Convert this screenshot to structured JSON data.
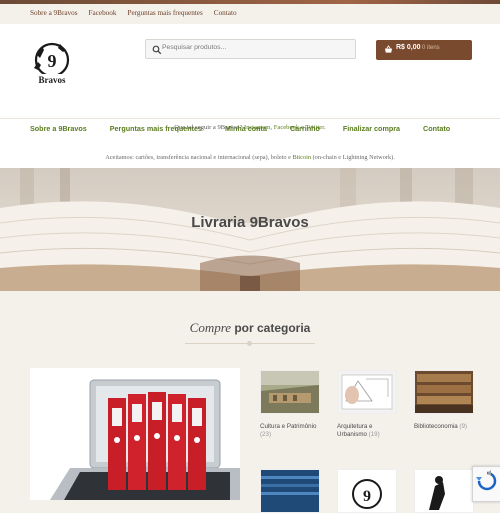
{
  "secondary_nav": [
    "Sobre a 9Bravos",
    "Facebook",
    "Perguntas mais frequentes",
    "Contato"
  ],
  "logo": {
    "text": "9 Bravos"
  },
  "search": {
    "placeholder": "Pesquisar produtos..."
  },
  "cart": {
    "amount": "R$ 0,00",
    "count": "0 itens"
  },
  "primary_nav": [
    "Sobre a 9Bravos",
    "Perguntas mais frequentes",
    "Minha conta",
    "Carrinho",
    "Finalizar compra",
    "Contato"
  ],
  "notice1": {
    "prefix": "Que tal seguir a 9Bravos? ",
    "instagram": "Instagram",
    "sep1": ", ",
    "facebook": "Facebook",
    "sep2": " e ",
    "twitter": "Twitter",
    "suffix": "."
  },
  "notice2": {
    "prefix": "Aceitamos: cartões, transferência nacional e internacional (sepa), boleto e ",
    "bitcoin": "Bitcoin",
    "suffix": " (on-chain e Lightning Network)."
  },
  "hero": {
    "title": "Livraria 9Bravos"
  },
  "section": {
    "title_italic": "Compre",
    "title_bold": "por categoria"
  },
  "categories": [
    {
      "name": "Cultura e Patrimônio",
      "count": "(23)"
    },
    {
      "name": "Arquitetura e Urbanismo",
      "count": "(19)"
    },
    {
      "name": "Biblioteconomia",
      "count": "(9)"
    }
  ],
  "colors": {
    "brand_brown": "#7a4a2e",
    "nav_green": "#5a7d1f",
    "link_brown": "#6b3e26"
  }
}
